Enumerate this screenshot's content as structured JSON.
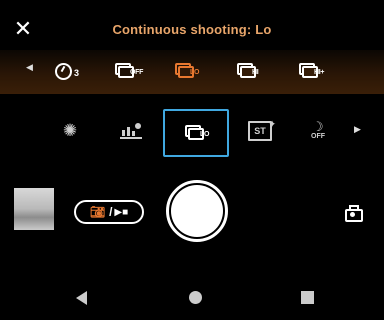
{
  "header": {
    "close_icon": "close-icon",
    "title": "Continuous shooting: Lo",
    "title_color": "#e8a56a"
  },
  "drive_options": {
    "items": [
      {
        "icon": "self-timer-icon",
        "label": "3"
      },
      {
        "icon": "burst-off-icon",
        "label": "OFF"
      },
      {
        "icon": "burst-lo-icon",
        "label": "LO",
        "selected": true,
        "color": "#e87830"
      },
      {
        "icon": "burst-hi-icon",
        "label": "HI"
      },
      {
        "icon": "burst-hi-plus-icon",
        "label": "HI+"
      }
    ]
  },
  "settings_row": {
    "items": [
      {
        "icon": "flash-off-icon",
        "glyph": "✺"
      },
      {
        "icon": "scene-recognition-icon"
      },
      {
        "icon": "continuous-shooting-icon",
        "label": "LO",
        "selected": true,
        "highlight_color": "#40a8e0"
      },
      {
        "icon": "st-icon",
        "label": "ST"
      },
      {
        "icon": "night-off-icon",
        "label": "OFF"
      }
    ]
  },
  "capture": {
    "mode_toggle": {
      "photo_icon": "camera-icon",
      "separator": "/",
      "video_icon": "video-icon",
      "video_glyph": "▶■"
    },
    "shutter": "shutter-button",
    "switch_camera": "switch-camera-icon"
  },
  "nav_bar": {
    "back": "back-icon",
    "home": "home-icon",
    "recents": "recents-icon"
  }
}
